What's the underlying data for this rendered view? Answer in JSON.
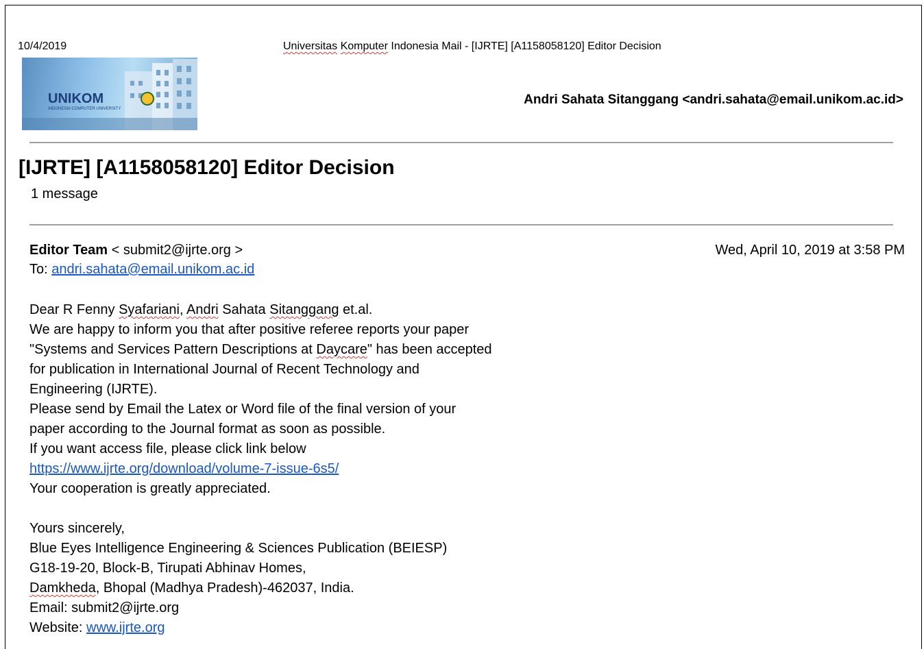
{
  "header": {
    "print_date": "10/4/2019",
    "print_title_prefix_1": "Universitas",
    "print_title_prefix_2": "Komputer",
    "print_title_rest": " Indonesia Mail - [IJRTE] [A1158058120] Editor Decision",
    "logo_text": "UNIKOM",
    "logo_subtext": "INDONESIA COMPUTER UNIVERSITY",
    "account": "Andri Sahata Sitanggang <andri.sahata@email.unikom.ac.id>"
  },
  "thread": {
    "subject": "[IJRTE] [A1158058120] Editor Decision",
    "message_count": "1 message"
  },
  "message": {
    "sender_name": "Editor Team",
    "sender_email": " < submit2@ijrte.org >",
    "date": "Wed, April 10, 2019 at 3:58 PM",
    "to_label": "To: ",
    "to_email": "andri.sahata@email.unikom.ac.id",
    "greeting_a": "Dear R Fenny ",
    "greeting_b": "Syafariani",
    "greeting_c": ", ",
    "greeting_d": "Andri",
    "greeting_e": " Sahata ",
    "greeting_f": "Sitanggang",
    "greeting_g": " et.al.",
    "line1": "We are happy to inform you that after positive referee reports your paper",
    "line2a": "\"Systems and Services Pattern Descriptions at ",
    "line2b": "Daycare",
    "line2c": "\" has been accepted",
    "line3": "for publication in International Journal of Recent Technology and",
    "line4": "Engineering (IJRTE).",
    "line5": "Please send by Email the Latex or Word file of the final version of your",
    "line6": "paper according to the Journal format as soon as possible.",
    "line7": "If you want access file, please click link below",
    "link": "https://www.ijrte.org/download/volume-7-issue-6s5/",
    "line8": "Your cooperation is greatly appreciated.",
    "sig1": "Yours sincerely,",
    "sig2": "Blue Eyes Intelligence Engineering & Sciences Publication (BEIESP)",
    "sig3": "G18-19-20, Block-B, Tirupati Abhinav Homes,",
    "sig4a": "Damkheda",
    "sig4b": ", Bhopal (Madhya Pradesh)-462037, India.",
    "sig5": "Email: submit2@ijrte.org",
    "sig6_label": "Website: ",
    "sig6_link": "www.ijrte.org"
  }
}
